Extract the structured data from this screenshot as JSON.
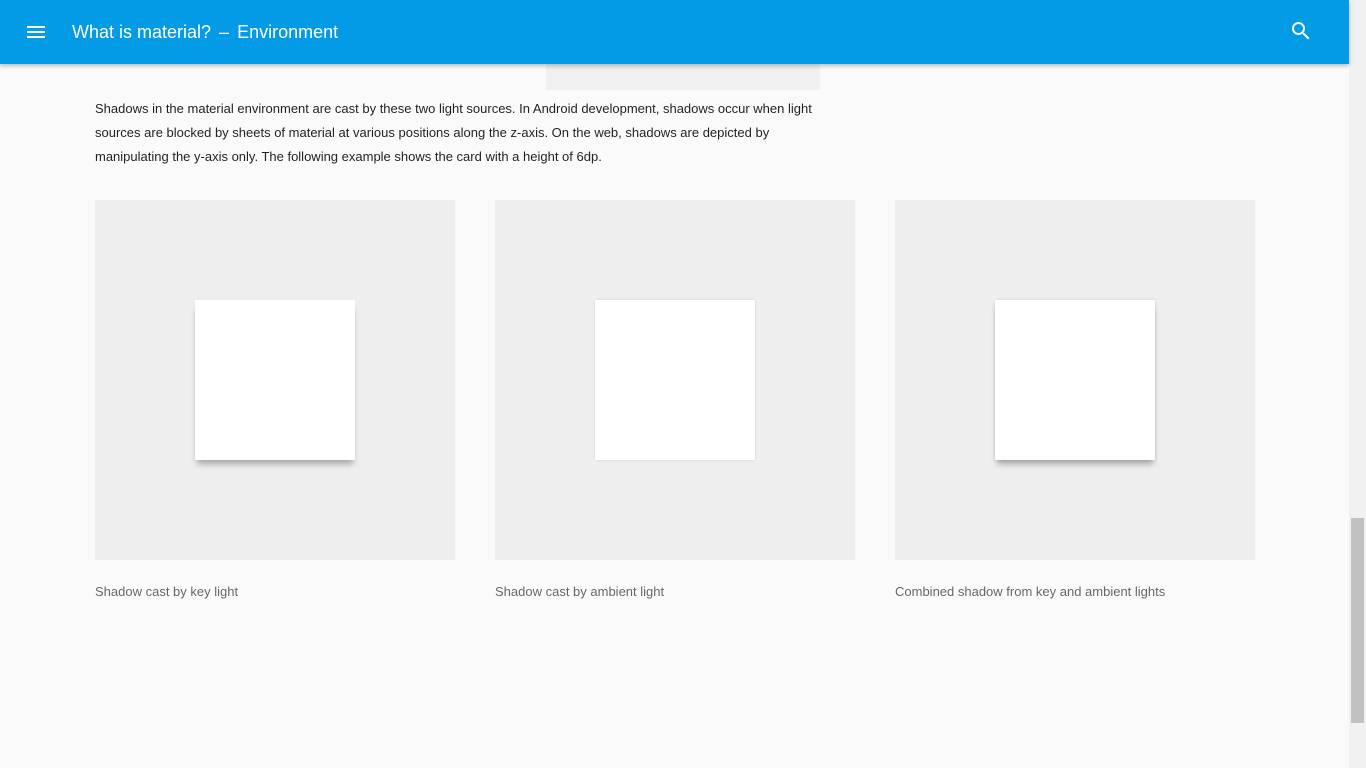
{
  "header": {
    "title": "What is material?",
    "separator": "–",
    "section": "Environment",
    "menu_icon": "menu-icon",
    "search_icon": "search-icon",
    "color": "#039be5"
  },
  "main": {
    "paragraph": "Shadows in the material environment are cast by these two light sources. In Android development, shadows occur when light sources are blocked by sheets of material at various positions along the z-axis. On the web, shadows are depicted by manipulating the y-axis only. The following example shows the card with a height of 6dp.",
    "demos": [
      {
        "caption": "Shadow cast by key light"
      },
      {
        "caption": "Shadow cast by ambient light"
      },
      {
        "caption": "Combined shadow from key and ambient lights"
      }
    ]
  }
}
